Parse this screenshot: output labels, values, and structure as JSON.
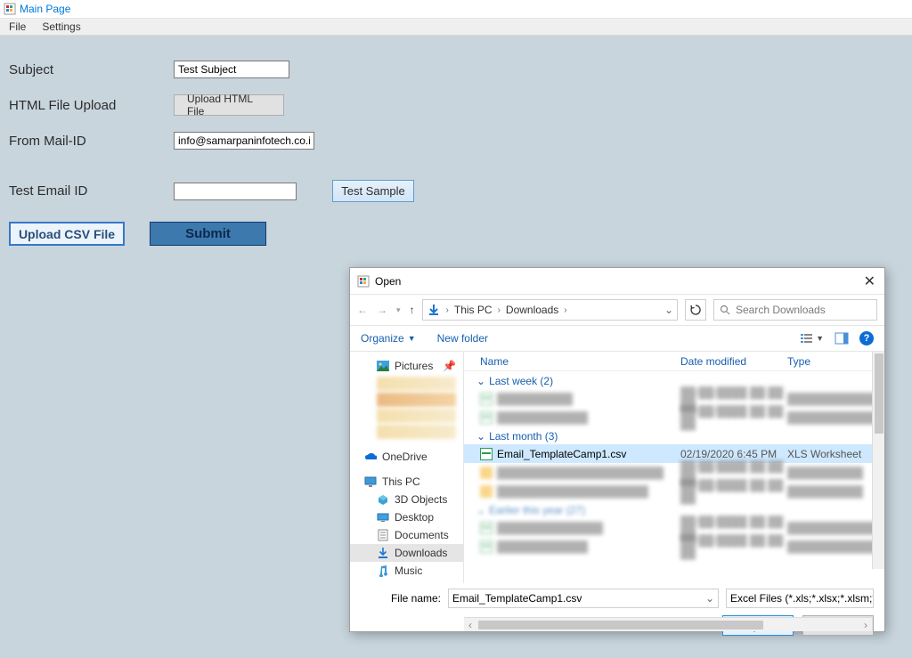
{
  "window": {
    "title": "Main Page"
  },
  "menu": {
    "file": "File",
    "settings": "Settings"
  },
  "form": {
    "subject_label": "Subject",
    "subject_value": "Test Subject",
    "html_upload_label": "HTML File Upload",
    "upload_html_btn": "Upload HTML File",
    "from_mail_label": "From Mail-ID",
    "from_mail_value": "info@samarpaninfotech.co.in",
    "test_email_label": "Test Email ID",
    "test_email_value": "",
    "test_sample_btn": "Test Sample",
    "upload_csv_btn": "Upload CSV File",
    "submit_btn": "Submit"
  },
  "open_dialog": {
    "title": "Open",
    "breadcrumb": {
      "root": "This PC",
      "folder": "Downloads"
    },
    "search_placeholder": "Search Downloads",
    "organize": "Organize",
    "new_folder": "New folder",
    "columns": {
      "name": "Name",
      "date": "Date modified",
      "type": "Type"
    },
    "nav": {
      "pictures": "Pictures",
      "onedrive": "OneDrive",
      "this_pc": "This PC",
      "objects3d": "3D Objects",
      "desktop": "Desktop",
      "documents": "Documents",
      "downloads": "Downloads",
      "music": "Music"
    },
    "groups": {
      "last_week": "Last week (2)",
      "last_month": "Last month (3)",
      "earlier_year": "Earlier this year (27)"
    },
    "selected_file": {
      "name": "Email_TemplateCamp1.csv",
      "date": "02/19/2020 6:45 PM",
      "type": "XLS Worksheet"
    },
    "filename_label": "File name:",
    "filename_value": "Email_TemplateCamp1.csv",
    "filter": "Excel Files (*.xls;*.xlsx;*.xlsm;*.c",
    "open_btn": "Open",
    "cancel_btn": "Cancel"
  }
}
